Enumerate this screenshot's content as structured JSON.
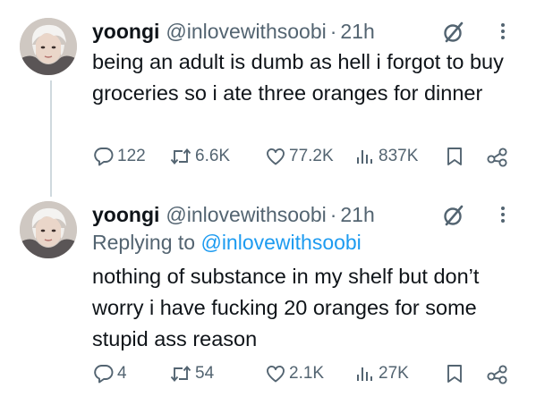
{
  "tweets": [
    {
      "author_name": "yoongi",
      "author_handle": "@inlovewithsoobi",
      "separator": "·",
      "time": "21h",
      "text": "being an adult is dumb as hell i forgot to buy groceries so i ate three oranges for dinner",
      "replies": "122",
      "reposts": "6.6K",
      "likes": "77.2K",
      "views": "837K"
    },
    {
      "author_name": "yoongi",
      "author_handle": "@inlovewithsoobi",
      "separator": "·",
      "time": "21h",
      "replying_label": "Replying to",
      "replying_to": "@inlovewithsoobi",
      "text": "nothing of substance in my shelf but don’t worry i have fucking 20 oranges for some stupid ass reason",
      "replies": "4",
      "reposts": "54",
      "likes": "2.1K",
      "views": "27K"
    }
  ],
  "icons": {
    "reply": "speech-bubble-icon",
    "repost": "repost-arrows-icon",
    "like": "heart-icon",
    "views": "bar-chart-icon",
    "bookmark": "bookmark-icon",
    "share": "share-icon",
    "grok": "grok-slash-circle-icon",
    "more": "vertical-dots-icon"
  },
  "colors": {
    "text_primary": "#0f1419",
    "text_secondary": "#536471",
    "link": "#1d9bf0",
    "thread_line": "#cfd9de"
  }
}
